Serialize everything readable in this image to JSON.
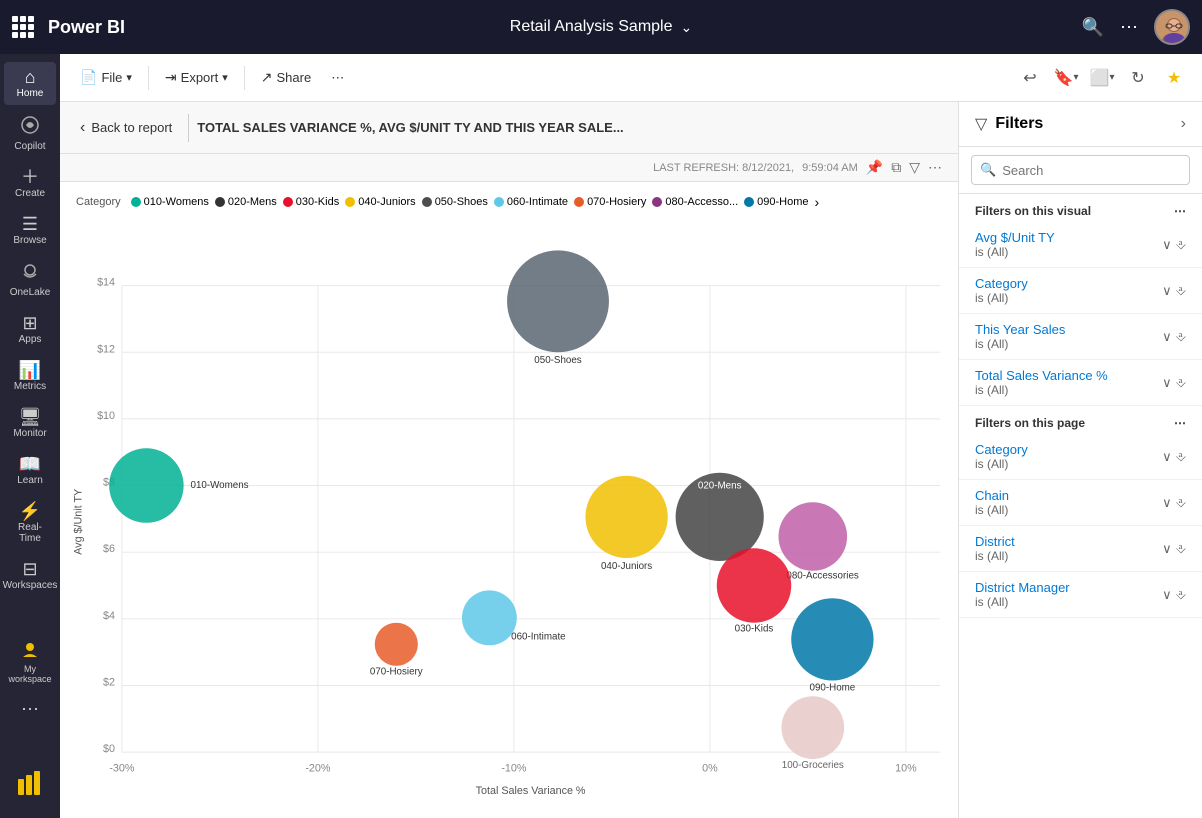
{
  "topbar": {
    "logo_text": "Power BI",
    "title": "Retail Analysis Sample",
    "title_chevron": "⌄",
    "search_icon": "🔍",
    "more_icon": "⋯"
  },
  "toolbar": {
    "file_label": "File",
    "export_label": "Export",
    "share_label": "Share",
    "more_icon": "⋯",
    "undo_icon": "↩",
    "bookmark_icon": "🔖",
    "view_icon": "⬜",
    "refresh_icon": "↻",
    "favorite_icon": "★"
  },
  "report_header": {
    "back_text": "Back to report",
    "title": "TOTAL SALES VARIANCE %, AVG $/UNIT TY AND THIS YEAR SALE..."
  },
  "refresh_info": {
    "label": "LAST REFRESH: 8/12/2021,",
    "time": "9:59:04 AM",
    "pin_icon": "📌",
    "copy_icon": "⧉",
    "filter_icon": "▽",
    "more_icon": "⋯"
  },
  "category_legend": {
    "label": "Category",
    "items": [
      {
        "name": "010-Womens",
        "color": "#00b294"
      },
      {
        "name": "020-Mens",
        "color": "#333333"
      },
      {
        "name": "030-Kids",
        "color": "#e8102a"
      },
      {
        "name": "040-Juniors",
        "color": "#f0c000"
      },
      {
        "name": "050-Shoes",
        "color": "#4d4d4d"
      },
      {
        "name": "060-Intimate",
        "color": "#5ec8e8"
      },
      {
        "name": "070-Hosiery",
        "color": "#e85c28"
      },
      {
        "name": "080-Accesso...",
        "color": "#8b3582"
      },
      {
        "name": "090-Home",
        "color": "#0078a8"
      }
    ]
  },
  "chart": {
    "x_axis_label": "Total Sales Variance %",
    "y_axis_label": "Avg $/Unit TY",
    "x_ticks": [
      "-30%",
      "-20%",
      "-10%",
      "0%",
      "10%"
    ],
    "y_ticks": [
      "$0",
      "$2",
      "$4",
      "$6",
      "$8",
      "$10",
      "$12",
      "$14"
    ],
    "bubbles": [
      {
        "label": "010-Womens",
        "color": "#00b294",
        "cx": 155,
        "cy": 305,
        "r": 38
      },
      {
        "label": "050-Shoes",
        "color": "#5a6672",
        "cx": 640,
        "cy": 95,
        "r": 52
      },
      {
        "label": "040-Juniors",
        "color": "#f0c000",
        "cx": 580,
        "cy": 340,
        "r": 42
      },
      {
        "label": "020-Mens",
        "color": "#444444",
        "cx": 690,
        "cy": 335,
        "r": 45
      },
      {
        "label": "080-Accessories",
        "color": "#8b3582",
        "cx": 790,
        "cy": 360,
        "r": 35
      },
      {
        "label": "030-Kids",
        "color": "#e8102a",
        "cx": 740,
        "cy": 395,
        "r": 38
      },
      {
        "label": "060-Intimate",
        "color": "#5ec8e8",
        "cx": 480,
        "cy": 430,
        "r": 30
      },
      {
        "label": "070-Hosiery",
        "color": "#e85c28",
        "cx": 400,
        "cy": 450,
        "r": 24
      },
      {
        "label": "090-Home",
        "color": "#0078a8",
        "cx": 800,
        "cy": 450,
        "r": 42
      },
      {
        "label": "100-Groceries",
        "color": "#e8c8c8",
        "cx": 790,
        "cy": 570,
        "r": 34
      }
    ]
  },
  "filters": {
    "title": "Filters",
    "search_placeholder": "Search",
    "expand_icon": "›",
    "visual_section": "Filters on this visual",
    "visual_more": "⋯",
    "page_section": "Filters on this page",
    "page_more": "⋯",
    "visual_filters": [
      {
        "name": "Avg $/Unit TY",
        "value": "is (All)"
      },
      {
        "name": "Category",
        "value": "is (All)"
      },
      {
        "name": "This Year Sales",
        "value": "is (All)"
      },
      {
        "name": "Total Sales Variance %",
        "value": "is (All)"
      }
    ],
    "page_filters": [
      {
        "name": "Category",
        "value": "is (All)"
      },
      {
        "name": "Chain",
        "value": "is (All)"
      },
      {
        "name": "District",
        "value": "is (All)"
      },
      {
        "name": "District Manager",
        "value": "is (All)"
      }
    ]
  },
  "sidebar": {
    "items": [
      {
        "icon": "🏠",
        "label": "Home"
      },
      {
        "icon": "✨",
        "label": "Copilot"
      },
      {
        "icon": "➕",
        "label": "Create"
      },
      {
        "icon": "📋",
        "label": "Browse"
      },
      {
        "icon": "🔺",
        "label": "OneLake"
      },
      {
        "icon": "⊞",
        "label": "Apps"
      },
      {
        "icon": "📊",
        "label": "Metrics"
      },
      {
        "icon": "🖥",
        "label": "Monitor"
      },
      {
        "icon": "📖",
        "label": "Learn"
      },
      {
        "icon": "⚡",
        "label": "Real-Time"
      },
      {
        "icon": "⊟",
        "label": "Workspaces"
      },
      {
        "icon": "👤",
        "label": "My workspace"
      },
      {
        "icon": "⋯",
        "label": ""
      }
    ]
  }
}
